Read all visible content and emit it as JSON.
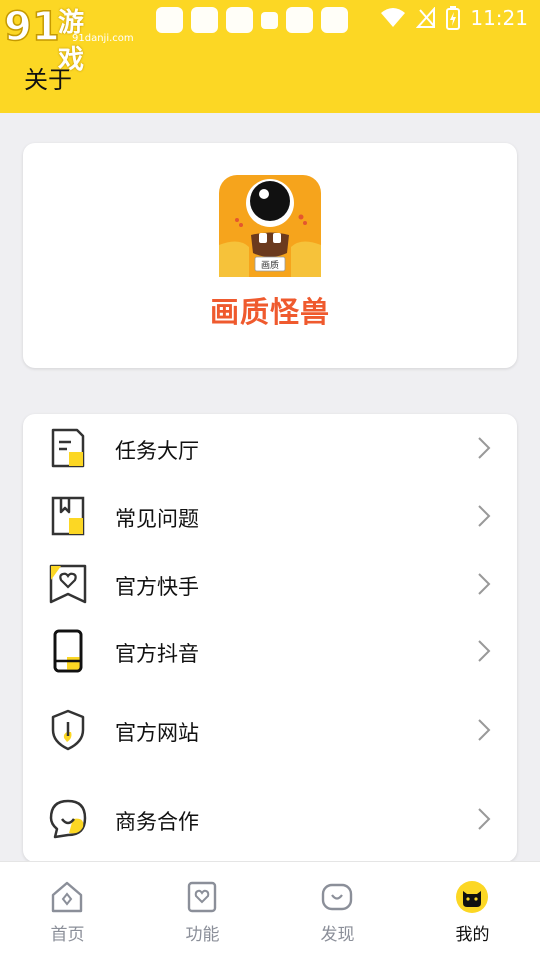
{
  "status_bar": {
    "time": "11:21"
  },
  "watermark": {
    "text": "游戏",
    "logo_digits": "91",
    "sub": "91danji.com"
  },
  "header": {
    "title": "关于"
  },
  "app": {
    "name": "画质怪兽",
    "icon_badge": "画质",
    "name_color": "#ef5a2e"
  },
  "menu": {
    "items": [
      {
        "label": "任务大厅",
        "icon": "task-hall-icon"
      },
      {
        "label": "常见问题",
        "icon": "faq-book-icon"
      },
      {
        "label": "官方快手",
        "icon": "kuaishou-heart-icon"
      },
      {
        "label": "官方抖音",
        "icon": "phone-icon"
      },
      {
        "label": "官方网站",
        "icon": "shield-site-icon"
      },
      {
        "label": "商务合作",
        "icon": "chat-bubble-icon"
      }
    ]
  },
  "tabbar": {
    "tabs": [
      {
        "label": "首页",
        "icon": "home-icon",
        "active": false
      },
      {
        "label": "功能",
        "icon": "feature-heart-icon",
        "active": false
      },
      {
        "label": "发现",
        "icon": "discover-icon",
        "active": false
      },
      {
        "label": "我的",
        "icon": "cat-avatar-icon",
        "active": true
      }
    ]
  },
  "colors": {
    "accent": "#fcd724",
    "background": "#efeff2",
    "text": "#111111",
    "tab_inactive": "#8b8f99"
  }
}
